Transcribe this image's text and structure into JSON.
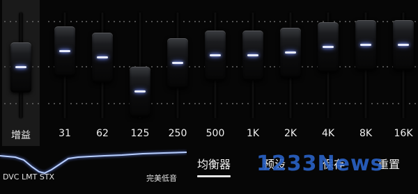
{
  "equalizer": {
    "bands": [
      {
        "label": "增益",
        "level": 0.48
      },
      {
        "label": "31",
        "level": 0.63
      },
      {
        "label": "62",
        "level": 0.57
      },
      {
        "label": "125",
        "level": 0.25
      },
      {
        "label": "250",
        "level": 0.52
      },
      {
        "label": "500",
        "level": 0.59
      },
      {
        "label": "1K",
        "level": 0.59
      },
      {
        "label": "2K",
        "level": 0.62
      },
      {
        "label": "4K",
        "level": 0.67
      },
      {
        "label": "8K",
        "level": 0.69
      },
      {
        "label": "16K",
        "level": 0.69
      }
    ]
  },
  "curve": {
    "left_caption": "DVC LMT STX",
    "right_caption": "完美低音"
  },
  "tabs": [
    {
      "label": "均衡器",
      "active": true
    },
    {
      "label": "预设",
      "active": false
    },
    {
      "label": "保存",
      "active": false
    },
    {
      "label": "重置",
      "active": false
    }
  ],
  "watermark": "1233News",
  "colors": {
    "knob_indicator": "#e8ecff",
    "curve": "#b9d0ff",
    "watermark": "#2a63c7"
  }
}
